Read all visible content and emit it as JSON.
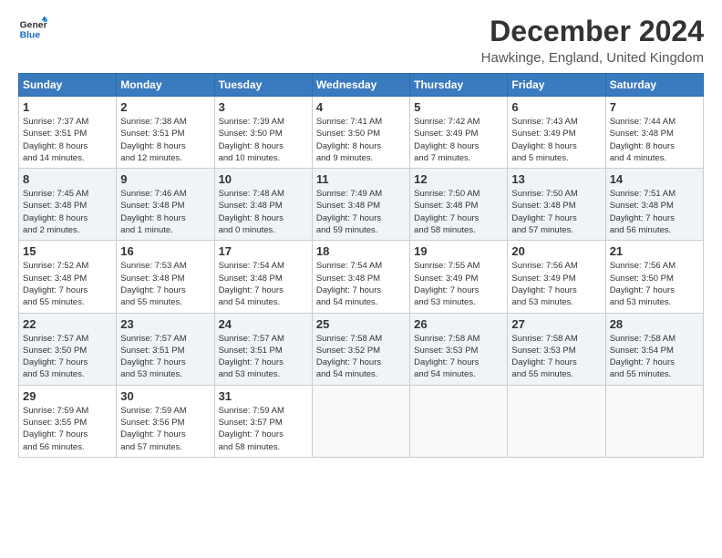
{
  "header": {
    "logo_line1": "General",
    "logo_line2": "Blue",
    "title": "December 2024",
    "location": "Hawkinge, England, United Kingdom"
  },
  "days_of_week": [
    "Sunday",
    "Monday",
    "Tuesday",
    "Wednesday",
    "Thursday",
    "Friday",
    "Saturday"
  ],
  "weeks": [
    [
      {
        "day": "1",
        "lines": [
          "Sunrise: 7:37 AM",
          "Sunset: 3:51 PM",
          "Daylight: 8 hours",
          "and 14 minutes."
        ]
      },
      {
        "day": "2",
        "lines": [
          "Sunrise: 7:38 AM",
          "Sunset: 3:51 PM",
          "Daylight: 8 hours",
          "and 12 minutes."
        ]
      },
      {
        "day": "3",
        "lines": [
          "Sunrise: 7:39 AM",
          "Sunset: 3:50 PM",
          "Daylight: 8 hours",
          "and 10 minutes."
        ]
      },
      {
        "day": "4",
        "lines": [
          "Sunrise: 7:41 AM",
          "Sunset: 3:50 PM",
          "Daylight: 8 hours",
          "and 9 minutes."
        ]
      },
      {
        "day": "5",
        "lines": [
          "Sunrise: 7:42 AM",
          "Sunset: 3:49 PM",
          "Daylight: 8 hours",
          "and 7 minutes."
        ]
      },
      {
        "day": "6",
        "lines": [
          "Sunrise: 7:43 AM",
          "Sunset: 3:49 PM",
          "Daylight: 8 hours",
          "and 5 minutes."
        ]
      },
      {
        "day": "7",
        "lines": [
          "Sunrise: 7:44 AM",
          "Sunset: 3:48 PM",
          "Daylight: 8 hours",
          "and 4 minutes."
        ]
      }
    ],
    [
      {
        "day": "8",
        "lines": [
          "Sunrise: 7:45 AM",
          "Sunset: 3:48 PM",
          "Daylight: 8 hours",
          "and 2 minutes."
        ]
      },
      {
        "day": "9",
        "lines": [
          "Sunrise: 7:46 AM",
          "Sunset: 3:48 PM",
          "Daylight: 8 hours",
          "and 1 minute."
        ]
      },
      {
        "day": "10",
        "lines": [
          "Sunrise: 7:48 AM",
          "Sunset: 3:48 PM",
          "Daylight: 8 hours",
          "and 0 minutes."
        ]
      },
      {
        "day": "11",
        "lines": [
          "Sunrise: 7:49 AM",
          "Sunset: 3:48 PM",
          "Daylight: 7 hours",
          "and 59 minutes."
        ]
      },
      {
        "day": "12",
        "lines": [
          "Sunrise: 7:50 AM",
          "Sunset: 3:48 PM",
          "Daylight: 7 hours",
          "and 58 minutes."
        ]
      },
      {
        "day": "13",
        "lines": [
          "Sunrise: 7:50 AM",
          "Sunset: 3:48 PM",
          "Daylight: 7 hours",
          "and 57 minutes."
        ]
      },
      {
        "day": "14",
        "lines": [
          "Sunrise: 7:51 AM",
          "Sunset: 3:48 PM",
          "Daylight: 7 hours",
          "and 56 minutes."
        ]
      }
    ],
    [
      {
        "day": "15",
        "lines": [
          "Sunrise: 7:52 AM",
          "Sunset: 3:48 PM",
          "Daylight: 7 hours",
          "and 55 minutes."
        ]
      },
      {
        "day": "16",
        "lines": [
          "Sunrise: 7:53 AM",
          "Sunset: 3:48 PM",
          "Daylight: 7 hours",
          "and 55 minutes."
        ]
      },
      {
        "day": "17",
        "lines": [
          "Sunrise: 7:54 AM",
          "Sunset: 3:48 PM",
          "Daylight: 7 hours",
          "and 54 minutes."
        ]
      },
      {
        "day": "18",
        "lines": [
          "Sunrise: 7:54 AM",
          "Sunset: 3:48 PM",
          "Daylight: 7 hours",
          "and 54 minutes."
        ]
      },
      {
        "day": "19",
        "lines": [
          "Sunrise: 7:55 AM",
          "Sunset: 3:49 PM",
          "Daylight: 7 hours",
          "and 53 minutes."
        ]
      },
      {
        "day": "20",
        "lines": [
          "Sunrise: 7:56 AM",
          "Sunset: 3:49 PM",
          "Daylight: 7 hours",
          "and 53 minutes."
        ]
      },
      {
        "day": "21",
        "lines": [
          "Sunrise: 7:56 AM",
          "Sunset: 3:50 PM",
          "Daylight: 7 hours",
          "and 53 minutes."
        ]
      }
    ],
    [
      {
        "day": "22",
        "lines": [
          "Sunrise: 7:57 AM",
          "Sunset: 3:50 PM",
          "Daylight: 7 hours",
          "and 53 minutes."
        ]
      },
      {
        "day": "23",
        "lines": [
          "Sunrise: 7:57 AM",
          "Sunset: 3:51 PM",
          "Daylight: 7 hours",
          "and 53 minutes."
        ]
      },
      {
        "day": "24",
        "lines": [
          "Sunrise: 7:57 AM",
          "Sunset: 3:51 PM",
          "Daylight: 7 hours",
          "and 53 minutes."
        ]
      },
      {
        "day": "25",
        "lines": [
          "Sunrise: 7:58 AM",
          "Sunset: 3:52 PM",
          "Daylight: 7 hours",
          "and 54 minutes."
        ]
      },
      {
        "day": "26",
        "lines": [
          "Sunrise: 7:58 AM",
          "Sunset: 3:53 PM",
          "Daylight: 7 hours",
          "and 54 minutes."
        ]
      },
      {
        "day": "27",
        "lines": [
          "Sunrise: 7:58 AM",
          "Sunset: 3:53 PM",
          "Daylight: 7 hours",
          "and 55 minutes."
        ]
      },
      {
        "day": "28",
        "lines": [
          "Sunrise: 7:58 AM",
          "Sunset: 3:54 PM",
          "Daylight: 7 hours",
          "and 55 minutes."
        ]
      }
    ],
    [
      {
        "day": "29",
        "lines": [
          "Sunrise: 7:59 AM",
          "Sunset: 3:55 PM",
          "Daylight: 7 hours",
          "and 56 minutes."
        ]
      },
      {
        "day": "30",
        "lines": [
          "Sunrise: 7:59 AM",
          "Sunset: 3:56 PM",
          "Daylight: 7 hours",
          "and 57 minutes."
        ]
      },
      {
        "day": "31",
        "lines": [
          "Sunrise: 7:59 AM",
          "Sunset: 3:57 PM",
          "Daylight: 7 hours",
          "and 58 minutes."
        ]
      },
      null,
      null,
      null,
      null
    ]
  ]
}
